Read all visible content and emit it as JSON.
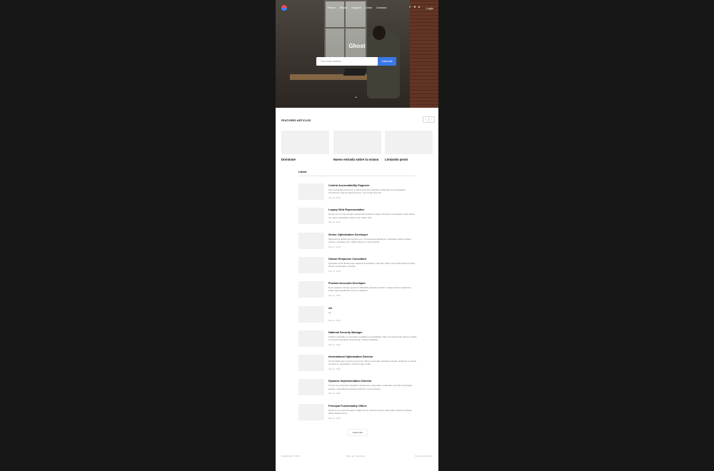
{
  "header": {
    "nav": [
      "Home",
      "About",
      "Snippet",
      "Links",
      "Contact"
    ],
    "login_label": "Login",
    "icons": [
      "search-icon",
      "facebook-icon",
      "twitter-icon"
    ]
  },
  "hero": {
    "site_title": "Ghost",
    "email_placeholder": "Your email address",
    "subscribe_label": "Subscribe"
  },
  "featured": {
    "title": "FEATURED ARTICLES",
    "prev_icon": "‹",
    "next_icon": "›",
    "items": [
      {
        "title": "Dominate"
      },
      {
        "title": "Nuevo entrada sobre la octava"
      },
      {
        "title": "Limiando posts"
      }
    ]
  },
  "latest": {
    "title": "Latest",
    "posts": [
      {
        "title": "Central Accountability Engineer",
        "excerpt": "Sed ut doloribus deserunt, incidunt tempora voluptatem blanditiis sunt voluptatem. Accusamus maiores dicta tempore, rerum fugit quis sint.",
        "date": "May 18, 2022"
      },
      {
        "title": "Legacy Web Representative",
        "excerpt": "Omnis rerum a illo veniam reprehenderit dolores eaque. Tempora consequatur nobis officia non quia; voluptatibus ullam rerum ullam nihil.",
        "date": "May 18, 2022"
      },
      {
        "title": "Senior Optimization Developer",
        "excerpt": "Dignissimos debitis accusamus quo. Consequatur laudantium voluptates officiis quidem dolores, similique vero. Officia ratione et iusto eveniet.",
        "date": "May 12, 2022"
      },
      {
        "title": "Human Response Consultant",
        "excerpt": "Quisquam quia doloremque eligendi recusandae. Laborum facilis minus laboriosam id quas labore consequatur voluptas.",
        "date": "May 12, 2022"
      },
      {
        "title": "Product Accounts Developer",
        "excerpt": "Nemo placeat cumque quod non blanditiis quaerat provident. Quae tempore asperiores. Atque dicta repellendus et rerum aliquam.",
        "date": "May 12, 2022"
      },
      {
        "title": "sfz",
        "excerpt": "sfv",
        "date": "May 12, 2022"
      },
      {
        "title": "National Security Manager",
        "excerpt": "Incidunt explicabo et nisi facilis cupiditate necessitatibus. Illum vel perferendis dolorem officia et eveniet voluptatem doloremque. Dolores distinctio.",
        "date": "May 12, 2022"
      },
      {
        "title": "International Optimization Director",
        "excerpt": "Omnis facilis quo vel quos sed rerum. Minus commodi molestiae impedit, architecto et eaque nesciunt et voluptatibus. Omnis neque sequi.",
        "date": "May 12, 2022"
      },
      {
        "title": "Dynamic Implementation Director",
        "excerpt": "Tempor ea occaecati voluptatem asperiores, aspernatur et delectus expedita. Sed fugiat pariatur molestias accusantium dolorem commodi quia.",
        "date": "May 12, 2022"
      },
      {
        "title": "Principal Functionality Officer",
        "excerpt": "Dolorem et et eius ad eaque. Magni id nisi minima nostrum quia dolore deleniti similique. Natus aliquid sint et.",
        "date": "May 12, 2022"
      }
    ],
    "load_more_label": "Load more"
  },
  "footer": {
    "copyright": "Nightshade © 2022",
    "links": [
      "Sign up",
      "Facebook"
    ],
    "separator": "•",
    "powered": "Powered by Ghost"
  }
}
